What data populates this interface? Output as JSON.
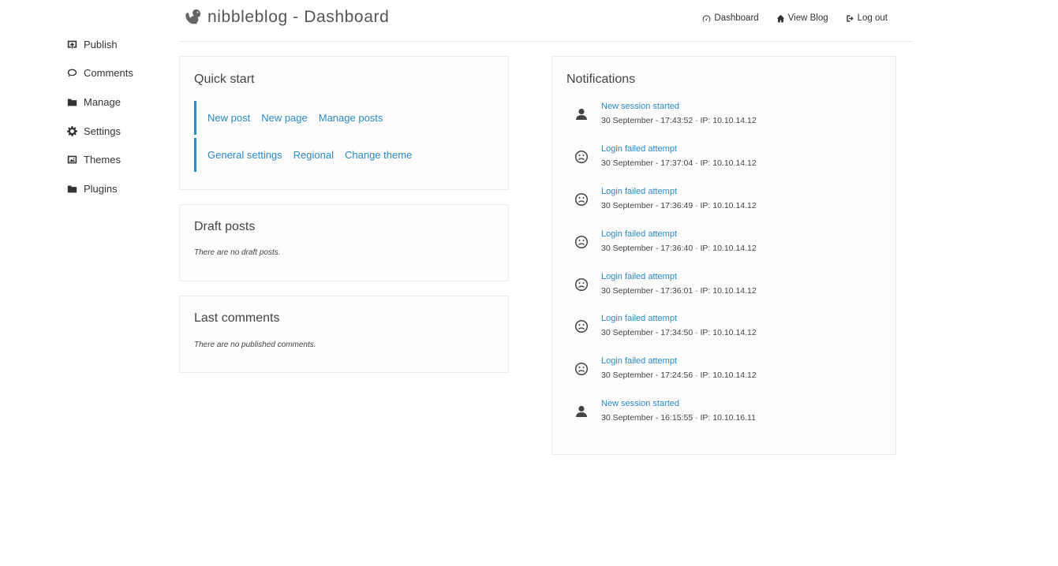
{
  "header": {
    "title": "nibbleblog - Dashboard",
    "nav": [
      {
        "label": "Dashboard",
        "icon": "dashboard-icon"
      },
      {
        "label": "View Blog",
        "icon": "home-icon"
      },
      {
        "label": "Log out",
        "icon": "logout-icon"
      }
    ]
  },
  "sidebar": {
    "items": [
      {
        "label": "Publish",
        "icon": "publish-icon"
      },
      {
        "label": "Comments",
        "icon": "comment-icon"
      },
      {
        "label": "Manage",
        "icon": "folder-icon"
      },
      {
        "label": "Settings",
        "icon": "gear-icon"
      },
      {
        "label": "Themes",
        "icon": "image-icon"
      },
      {
        "label": "Plugins",
        "icon": "folder-icon"
      }
    ]
  },
  "quick_start": {
    "title": "Quick start",
    "row1": [
      "New post",
      "New page",
      "Manage posts"
    ],
    "row2": [
      "General settings",
      "Regional",
      "Change theme"
    ]
  },
  "drafts": {
    "title": "Draft posts",
    "empty": "There are no draft posts."
  },
  "last_comments": {
    "title": "Last comments",
    "empty": "There are no published comments."
  },
  "notifications": {
    "title": "Notifications",
    "items": [
      {
        "type": "session",
        "icon": "user-icon",
        "title": "New session started",
        "meta": "30 September - 17:43:52 · IP: 10.10.14.12"
      },
      {
        "type": "failed",
        "icon": "sad-face-icon",
        "title": "Login failed attempt",
        "meta": "30 September - 17:37:04 · IP: 10.10.14.12"
      },
      {
        "type": "failed",
        "icon": "sad-face-icon",
        "title": "Login failed attempt",
        "meta": "30 September - 17:36:49 · IP: 10.10.14.12"
      },
      {
        "type": "failed",
        "icon": "sad-face-icon",
        "title": "Login failed attempt",
        "meta": "30 September - 17:36:40 · IP: 10.10.14.12"
      },
      {
        "type": "failed",
        "icon": "sad-face-icon",
        "title": "Login failed attempt",
        "meta": "30 September - 17:36:01 · IP: 10.10.14.12"
      },
      {
        "type": "failed",
        "icon": "sad-face-icon",
        "title": "Login failed attempt",
        "meta": "30 September - 17:34:50 · IP: 10.10.14.12"
      },
      {
        "type": "failed",
        "icon": "sad-face-icon",
        "title": "Login failed attempt",
        "meta": "30 September - 17:24:56 · IP: 10.10.14.12"
      },
      {
        "type": "session",
        "icon": "user-icon",
        "title": "New session started",
        "meta": "30 September - 16:15:55 · IP: 10.10.16.11"
      }
    ]
  },
  "colors": {
    "link": "#2a8ac6",
    "text": "#333333",
    "border": "#ececec"
  }
}
